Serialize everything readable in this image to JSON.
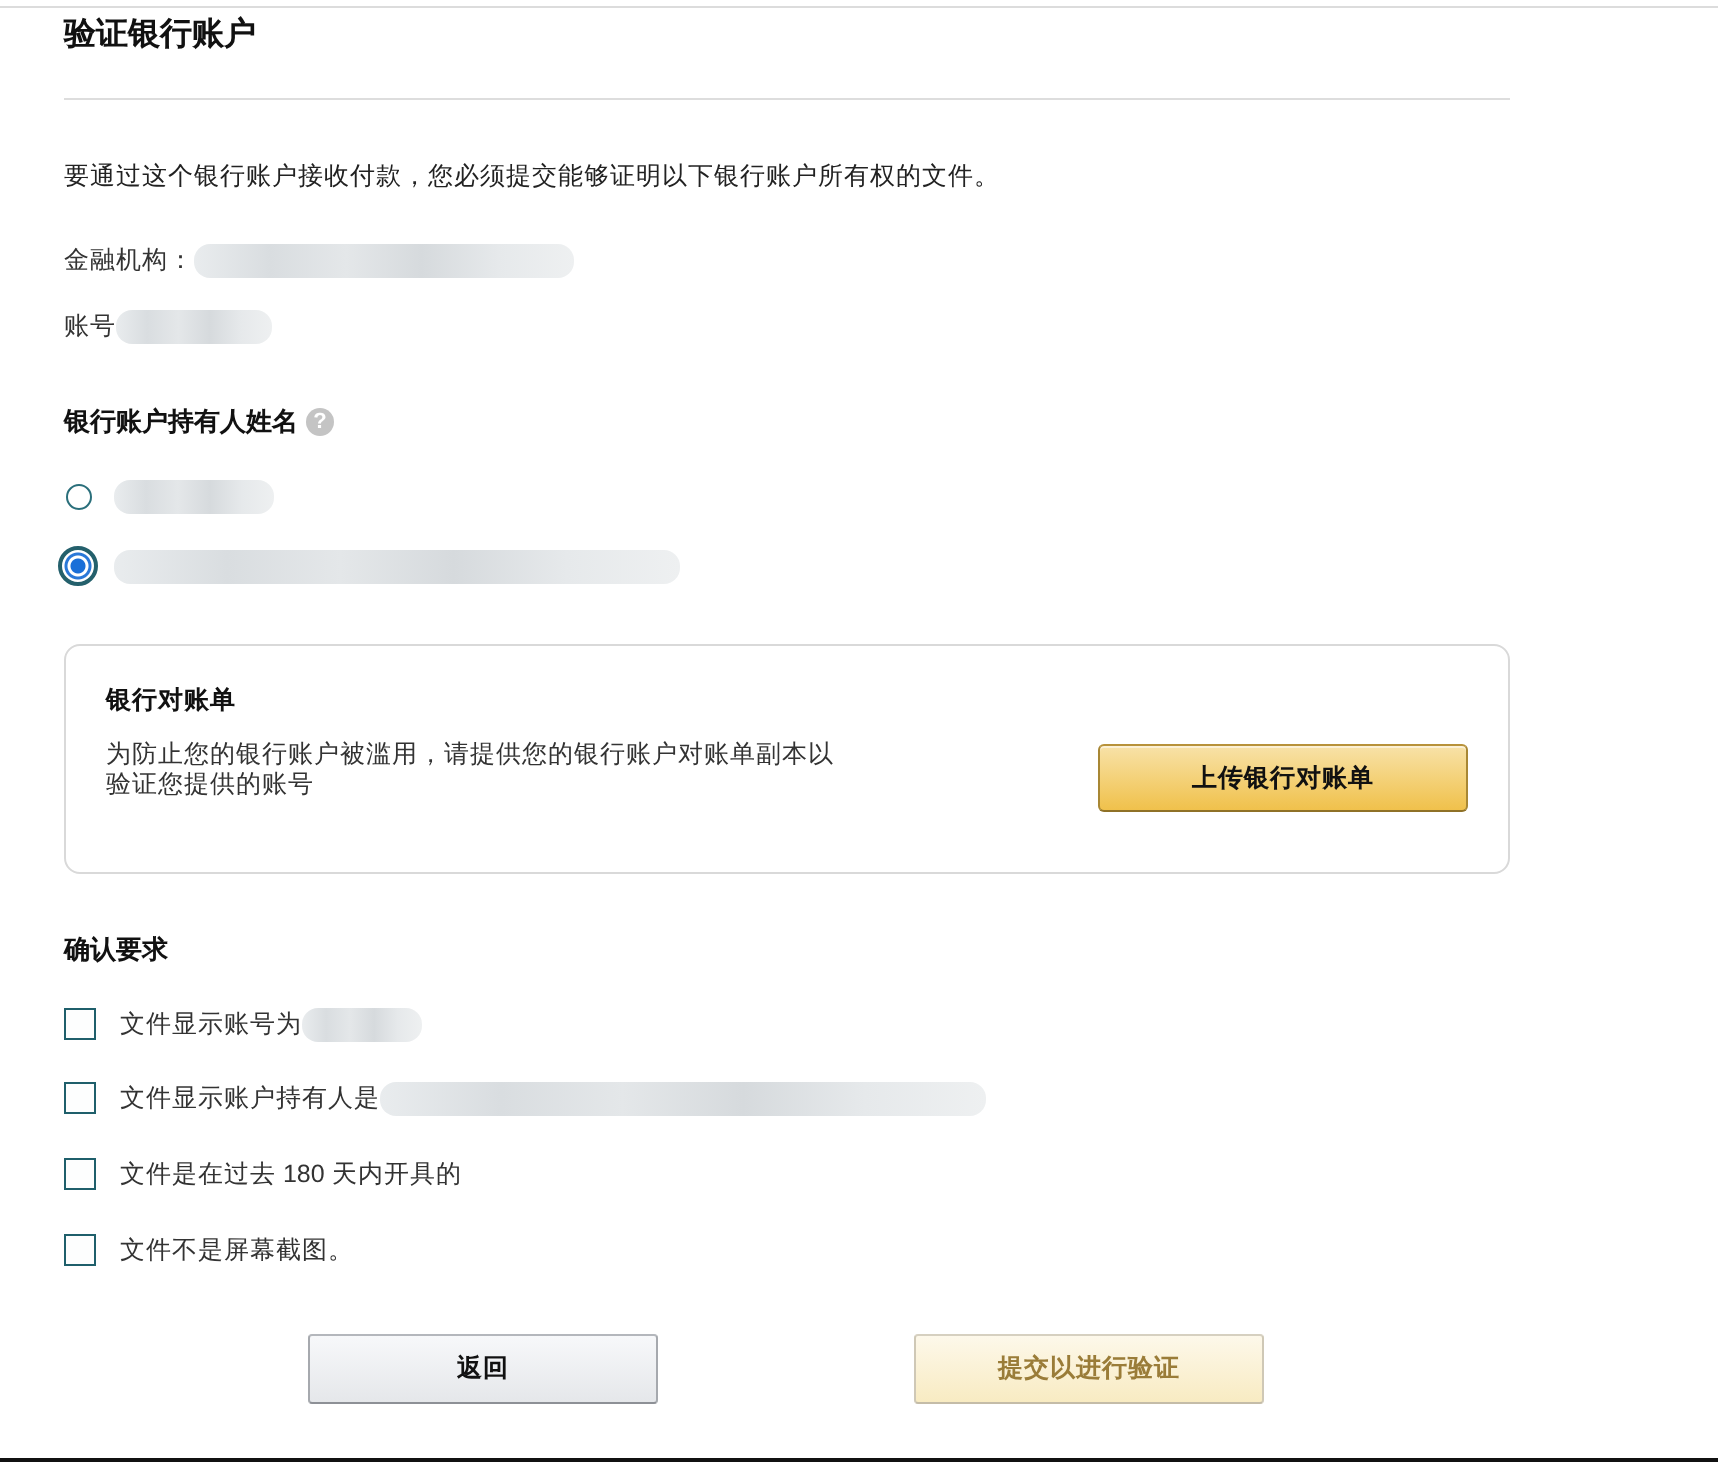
{
  "title": "验证银行账户",
  "intro": "要通过这个银行账户接收付款，您必须提交能够证明以下银行账户所有权的文件。",
  "fields": [
    {
      "label": "金融机构："
    },
    {
      "label": "账号"
    }
  ],
  "holder_name": {
    "heading": "银行账户持有人姓名",
    "help_icon": "?",
    "options": [
      {
        "selected": false
      },
      {
        "selected": true
      }
    ]
  },
  "statement_card": {
    "title": "银行对账单",
    "description": "为防止您的银行账户被滥用，请提供您的银行账户对账单副本以验证您提供的账号",
    "button": "上传银行对账单"
  },
  "requirements": {
    "heading": "确认要求",
    "items": [
      {
        "label": "文件显示账号为",
        "kind": "redacted",
        "checked": false
      },
      {
        "label": "文件显示账户持有人是",
        "kind": "redacted",
        "checked": false
      },
      {
        "label": "文件是在过去 180 天内开具的",
        "kind": "plain",
        "checked": false
      },
      {
        "label": "文件不是屏幕截图。",
        "kind": "plain",
        "checked": false
      }
    ]
  },
  "buttons": [
    {
      "label": "返回",
      "kind": "secondary",
      "disabled": false
    },
    {
      "label": "提交以进行验证",
      "kind": "primary",
      "disabled": true
    }
  ]
}
